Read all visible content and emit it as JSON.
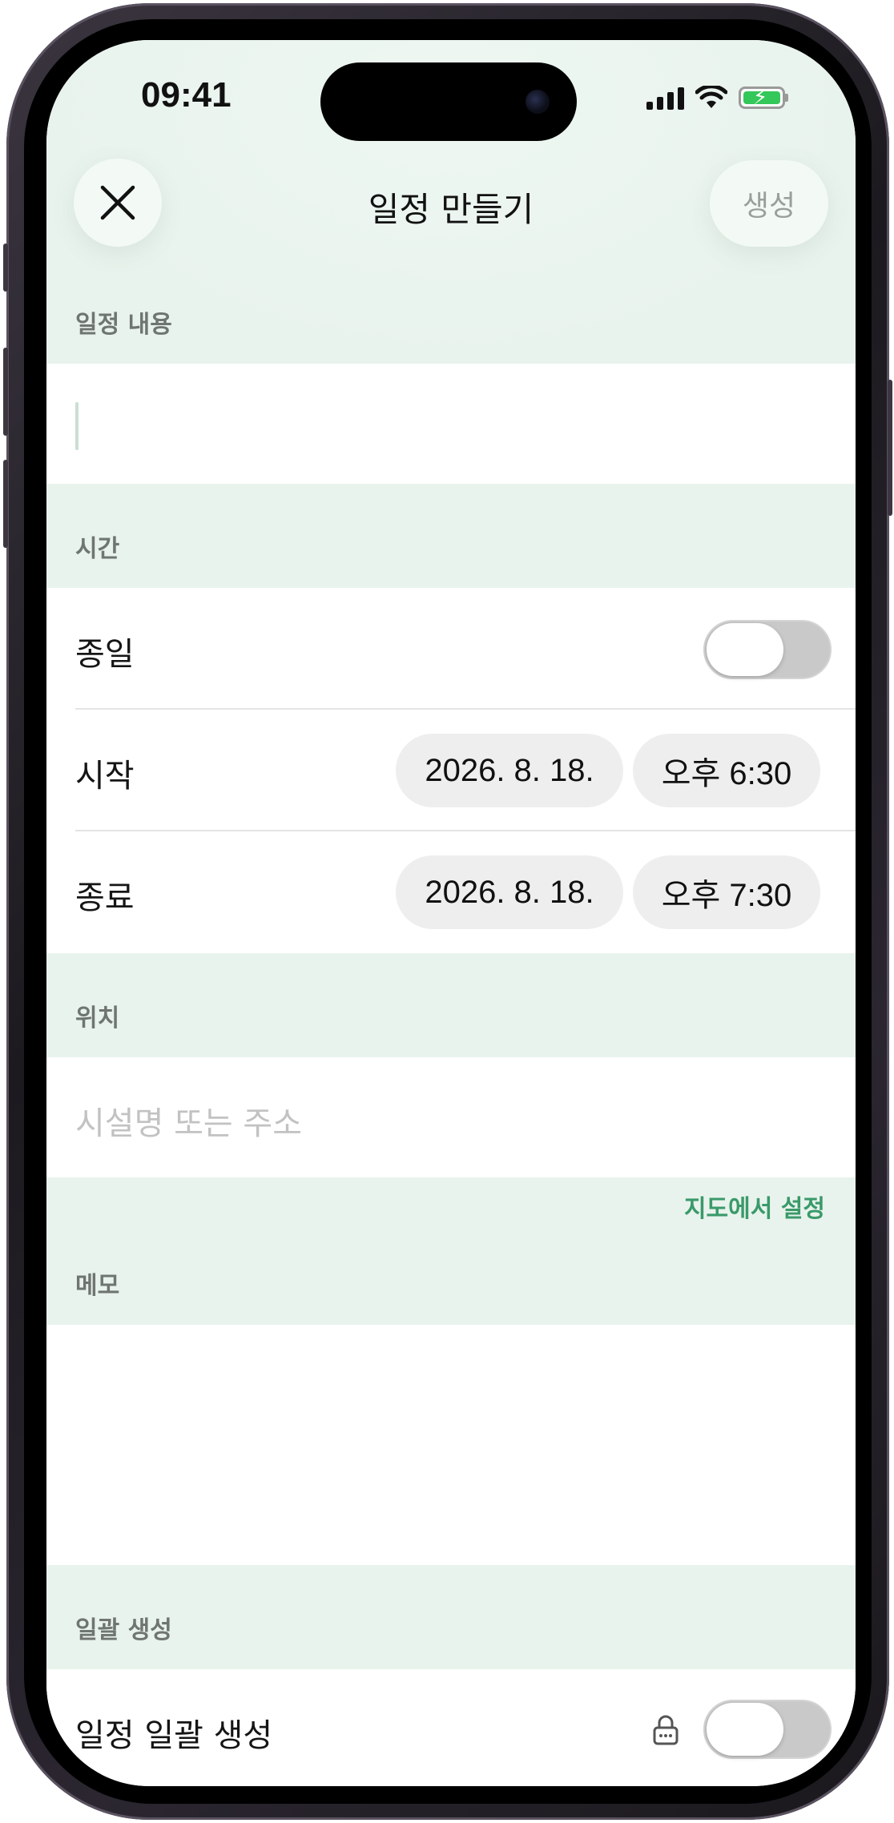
{
  "status_bar": {
    "time": "09:41",
    "icons": [
      "cellular-signal-icon",
      "wifi-icon",
      "battery-charging-icon"
    ]
  },
  "nav": {
    "close_icon": "close-icon",
    "title": "일정 만들기",
    "create_label": "생성"
  },
  "sections": {
    "content": {
      "label": "일정 내용",
      "input_value": ""
    },
    "time": {
      "label": "시간",
      "all_day_label": "종일",
      "all_day_on": false,
      "start_label": "시작",
      "start_date": "2026. 8. 18.",
      "start_time": "오후 6:30",
      "end_label": "종료",
      "end_date": "2026. 8. 18.",
      "end_time": "오후 7:30"
    },
    "location": {
      "label": "위치",
      "placeholder": "시설명 또는 주소",
      "map_link": "지도에서 설정"
    },
    "memo": {
      "label": "메모",
      "value": ""
    },
    "batch": {
      "label": "일괄 생성",
      "row_label": "일정 일괄 생성",
      "locked_icon": "lock-icon",
      "enabled": false
    }
  },
  "colors": {
    "background": "#e9f3ed",
    "accent": "#3a9a6a",
    "chip": "#eeeeee",
    "toggle_off": "#c9c9c9"
  }
}
